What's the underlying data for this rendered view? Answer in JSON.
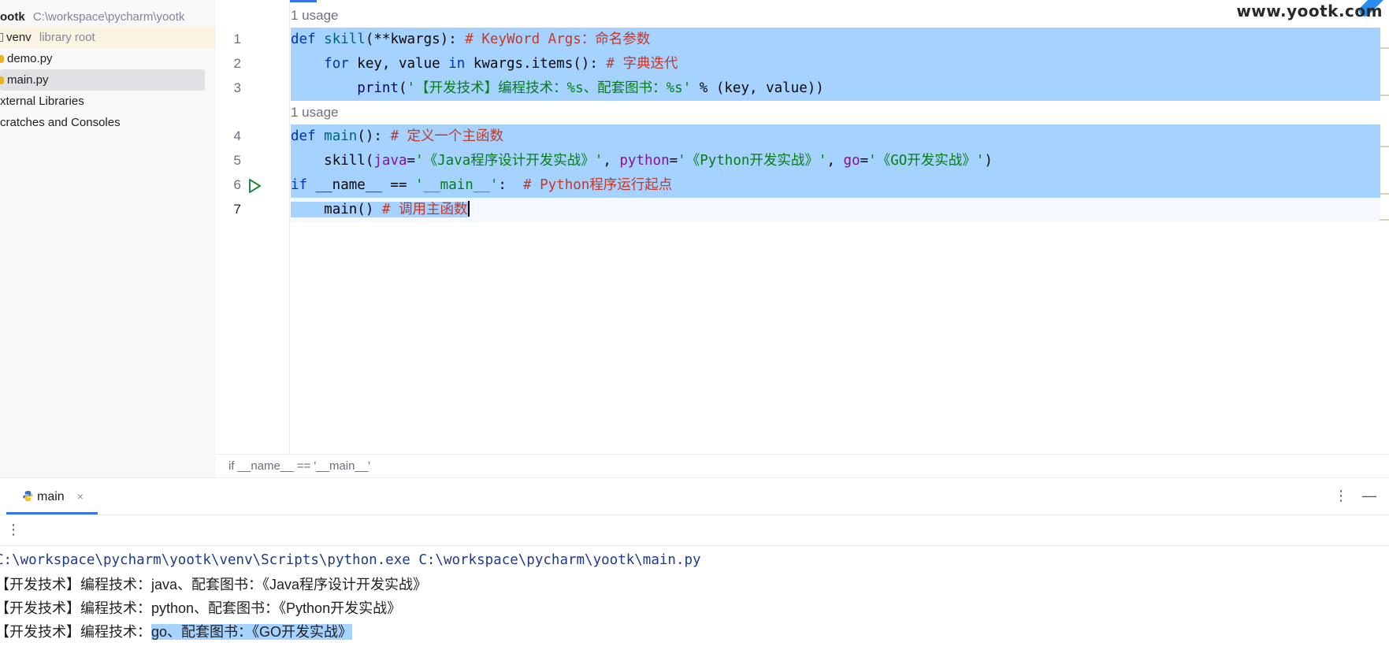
{
  "project_tree": {
    "root_name": "ootk",
    "root_path": "C:\\workspace\\pycharm\\yootk",
    "items": [
      {
        "label": "venv",
        "note": "library root"
      },
      {
        "label": "demo.py"
      },
      {
        "label": "main.py"
      },
      {
        "label": "xternal Libraries"
      },
      {
        "label": "cratches and Consoles"
      }
    ]
  },
  "editor": {
    "usage_hint_1": "1 usage",
    "usage_hint_2": "1 usage",
    "line_numbers": [
      "1",
      "2",
      "3",
      "4",
      "5",
      "6",
      "7"
    ],
    "code": {
      "l1": {
        "kw": "def",
        "name": "skill",
        "args": "(**kwargs):",
        "comment": "# KeyWord Args：命名参数"
      },
      "l2": {
        "kw_for": "for",
        "vars": " key, value ",
        "kw_in": "in",
        "expr": " kwargs.items(): ",
        "comment": "# 字典迭代"
      },
      "l3": {
        "fn": "print",
        "open": "(",
        "str": "'【开发技术】编程技术：%s、配套图书：%s'",
        "rest": " % (key, value))"
      },
      "l4": {
        "kw": "def",
        "name": "main",
        "args": "(): ",
        "comment": "# 定义一个主函数"
      },
      "l5": {
        "fn": "skill",
        "open": "(",
        "p1": "java",
        "eq1": "=",
        "s1": "'《Java程序设计开发实战》'",
        "sep1": ", ",
        "p2": "python",
        "eq2": "=",
        "s2": "'《Python开发实战》'",
        "sep2": ", ",
        "p3": "go",
        "eq3": "=",
        "s3": "'《GO开发实战》'",
        "close": ")"
      },
      "l6": {
        "kw": "if",
        "name": " __name__ == ",
        "str": "'__main__'",
        "colon": ":  ",
        "comment": "# Python程序运行起点"
      },
      "l7": {
        "call": "main() ",
        "comment": "# 调用主函数"
      }
    },
    "breadcrumb": "if __name__ == '__main__'"
  },
  "branding": {
    "site": "www.yootk.com"
  },
  "run_window": {
    "tab_label": "main",
    "tab_close": "×",
    "kebab": "⋮",
    "minimize": "—",
    "more": "⋮",
    "console": {
      "command": "C:\\workspace\\pycharm\\yootk\\venv\\Scripts\\python.exe C:\\workspace\\pycharm\\yootk\\main.py",
      "lines": [
        {
          "prefix": "【开发技术】编程技术：",
          "value": "java、配套图书：《Java程序设计开发实战》"
        },
        {
          "prefix": "【开发技术】编程技术：",
          "value": "python、配套图书：《Python开发实战》"
        },
        {
          "prefix": "【开发技术】编程技术：",
          "value": "go、配套图书：《GO开发实战》"
        }
      ]
    }
  },
  "colors": {
    "selection": "#a6d2ff",
    "keyword": "#0033b3",
    "string": "#067d17",
    "comment": "#8c8c8c",
    "param": "#871094",
    "accent": "#3574f0"
  }
}
